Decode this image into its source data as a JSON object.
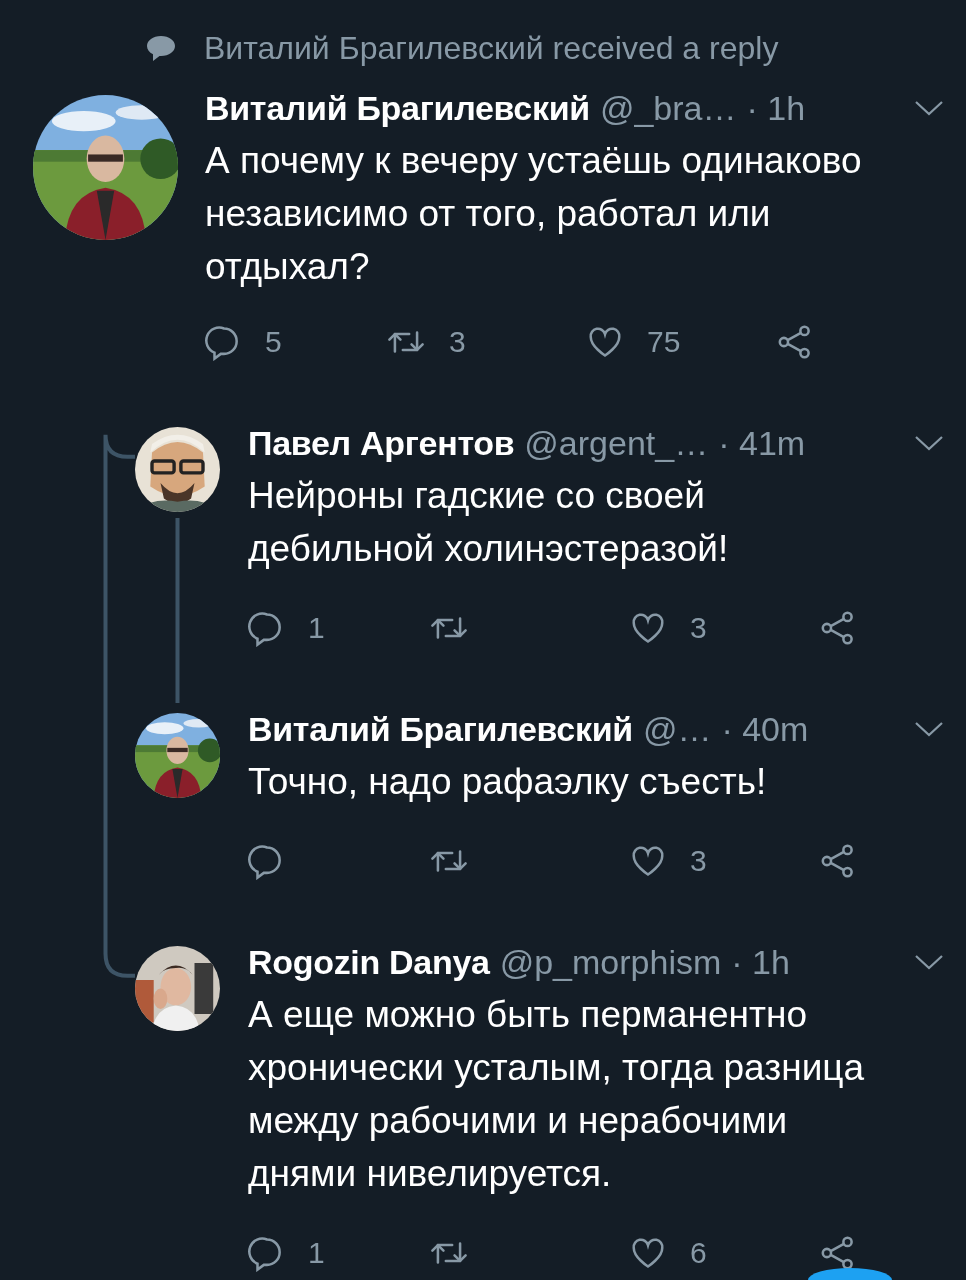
{
  "context": {
    "text": "Виталий Брагилевский received a reply"
  },
  "thread": {
    "name": "Виталий Брагилевский",
    "handle": "@_bra…",
    "time": "· 1h",
    "text": "А почему к вечеру устаёшь одинаково независимо от того, работал или отдыхал?",
    "replies": "5",
    "retweets": "3",
    "likes": "75",
    "avatar": {
      "kind": "picture"
    },
    "children": [
      {
        "name": "Павел Аргентов",
        "handle": "@argent_…",
        "time": "· 41m",
        "text": "Нейроны гадские со своей дебильной холинэстеразой!",
        "replies": "1",
        "likes": "3",
        "avatar": {
          "kind": "picture"
        },
        "children": [
          {
            "name": "Виталий Брагилевский",
            "handle": "@…",
            "time": "· 40m",
            "text": "Точно, надо рафаэлку съесть!",
            "likes": "3",
            "avatar": {
              "kind": "picture"
            }
          }
        ]
      },
      {
        "name": "Rogozin Danya",
        "handle": "@p_morphism",
        "time": "· 1h",
        "text": "А еще можно быть перманентно хронически усталым, тогда разница между рабочими и нерабочими днями нивелируется.",
        "replies": "1",
        "likes": "6",
        "avatar": {
          "kind": "picture"
        }
      }
    ]
  }
}
